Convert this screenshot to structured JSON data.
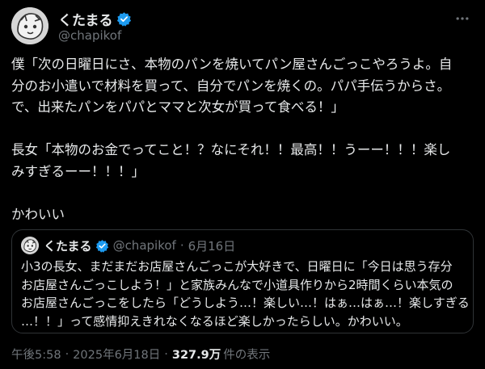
{
  "tweet": {
    "display_name": "くたまる",
    "handle": "@chapikof",
    "body_lines": [
      "僕「次の日曜日にさ、本物のパンを焼いてパン屋さんごっこやろうよ。自",
      "分のお小遣いで材料を買って、自分でパンを焼くの。パパ手伝うからさ。",
      "で、出来たパンをパパとママと次女が買って食べる！」",
      "",
      "長女「本物のお金でってこと！？なにそれ！！最高！！うーー！！！楽し",
      "みすぎるーー！！！」",
      "",
      "かわいい"
    ],
    "icons": {
      "verified": "verified-badge-icon",
      "more": "more-options-icon",
      "accent_color": "#1d9bf0"
    }
  },
  "quote": {
    "display_name": "くたまる",
    "handle": "@chapikof",
    "separator": "·",
    "date": "6月16日",
    "lines": [
      "小3の長女、まだまだお店屋さんごっこが大好きで、日曜日に「今日は思う存分",
      "お店屋さんごっこしよう！」と家族みんなで小道具作りから2時間くらい本気の",
      "お店屋さんごっこをしたら「どうしよう…！楽しい…！はぁ…はぁ…！楽しすぎる",
      "…！！」って感情抑えきれなくなるほど楽しかったらしい。かわいい。"
    ]
  },
  "footer": {
    "time": "午後5:58",
    "separator": "·",
    "date": "2025年6月18日",
    "views": "327.9万",
    "views_label": "件の表示"
  }
}
